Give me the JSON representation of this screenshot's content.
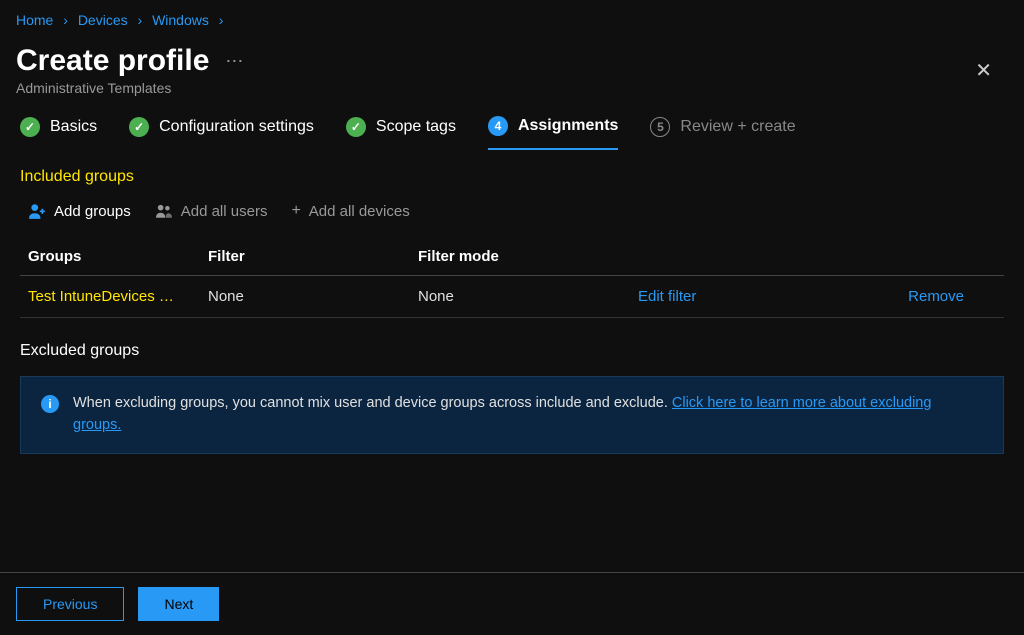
{
  "breadcrumb": {
    "home": "Home",
    "devices": "Devices",
    "windows": "Windows"
  },
  "header": {
    "title": "Create profile",
    "subtitle": "Administrative Templates"
  },
  "steps": {
    "basics": "Basics",
    "config": "Configuration settings",
    "scope": "Scope tags",
    "assignments": "Assignments",
    "assignments_num": "4",
    "review": "Review + create",
    "review_num": "5"
  },
  "included": {
    "title": "Included groups",
    "add_groups": "Add groups",
    "add_all_users": "Add all users",
    "add_all_devices": "Add all devices"
  },
  "table": {
    "col_groups": "Groups",
    "col_filter": "Filter",
    "col_filter_mode": "Filter mode",
    "row": {
      "group": "Test IntuneDevices …",
      "filter": "None",
      "filter_mode": "None",
      "edit": "Edit filter",
      "remove": "Remove"
    }
  },
  "excluded": {
    "title": "Excluded groups"
  },
  "info": {
    "text": "When excluding groups, you cannot mix user and device groups across include and exclude. ",
    "link": "Click here to learn more about excluding groups."
  },
  "footer": {
    "previous": "Previous",
    "next": "Next"
  }
}
